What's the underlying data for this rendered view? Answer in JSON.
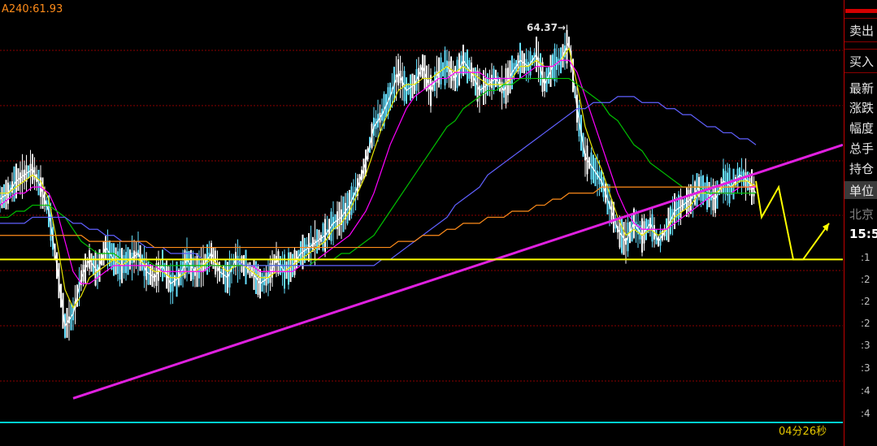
{
  "chart": {
    "ma_label": "A240:61.93",
    "peak_label": "64.37→",
    "countdown": "04分26秒"
  },
  "side_panel": {
    "sell_label": "卖出",
    "buy_label": "买入",
    "info_rows": [
      "最新",
      "涨跌",
      "幅度",
      "总手",
      "持仓"
    ],
    "unit_label": "单位",
    "city_label": "北京",
    "time_label": "15:5",
    "tick_labels": [
      ":1",
      ":2",
      ":2",
      ":2",
      ":3",
      ":3",
      ":4",
      ":4"
    ]
  },
  "colors": {
    "background": "#000000",
    "grid": "#8b0000",
    "trendline": "#e020e0",
    "support": "#ffff00",
    "bottom_line": "#00d0d0",
    "ma_white": "#ffffff",
    "ma_yellow": "#e6e600",
    "ma_magenta": "#ff00ff",
    "ma_green": "#00c000",
    "ma_blue": "#6060ff",
    "ma_orange": "#ff8c1a",
    "candle_up": "#66e0ff",
    "candle_down": "#ffffff"
  },
  "chart_data": {
    "type": "line",
    "title": "",
    "xlabel": "",
    "ylabel": "",
    "ylim": [
      58.0,
      65.0
    ],
    "peak": 64.37,
    "ma240": 61.93,
    "grid": true,
    "x": [
      0,
      10,
      20,
      30,
      40,
      50,
      60,
      70,
      80,
      90,
      100,
      110,
      120,
      130,
      140,
      150,
      160,
      170,
      180,
      190,
      200,
      210,
      220,
      230,
      240,
      250,
      260,
      270,
      280,
      290,
      300,
      310,
      320,
      330,
      340,
      350,
      360,
      370,
      380,
      390,
      400,
      410,
      420,
      430,
      440,
      450,
      460,
      470,
      480,
      490,
      500,
      510,
      520,
      530,
      540,
      550,
      560,
      570,
      580,
      590,
      600,
      610,
      620,
      630,
      640,
      650,
      660,
      670,
      680,
      690,
      700,
      710,
      720,
      730,
      740,
      750,
      760,
      770,
      780,
      790,
      800,
      810,
      820,
      830,
      840,
      850,
      860,
      870,
      880,
      890,
      900,
      910,
      920,
      930
    ],
    "series": [
      {
        "values": [
          61.7,
          61.8,
          62.0,
          62.1,
          62.2,
          61.9,
          61.5,
          60.6,
          59.6,
          59.8,
          60.4,
          60.7,
          60.5,
          60.9,
          60.7,
          60.6,
          60.7,
          60.8,
          60.5,
          60.4,
          60.6,
          60.3,
          60.4,
          60.7,
          60.5,
          60.6,
          60.8,
          60.5,
          60.4,
          60.7,
          60.6,
          60.5,
          60.3,
          60.4,
          60.7,
          60.5,
          60.6,
          60.8,
          60.9,
          61.0,
          61.1,
          61.3,
          61.4,
          61.6,
          61.9,
          62.3,
          62.9,
          63.1,
          63.4,
          63.8,
          63.5,
          63.6,
          63.9,
          63.5,
          63.8,
          63.9,
          63.7,
          64.0,
          63.8,
          63.5,
          63.6,
          63.7,
          63.5,
          63.8,
          64.0,
          63.9,
          64.1,
          63.6,
          63.9,
          64.0,
          64.3,
          63.2,
          62.4,
          62.2,
          62.0,
          61.6,
          61.2,
          61.0,
          61.3,
          61.1,
          61.3,
          61.0,
          61.2,
          61.5,
          61.6,
          61.7,
          61.9,
          61.8,
          61.7,
          62.0,
          61.9,
          62.1,
          62.0,
          61.8
        ]
      },
      {
        "values": [
          61.8,
          61.8,
          61.9,
          62.0,
          62.1,
          62.0,
          61.7,
          61.0,
          60.2,
          59.9,
          60.1,
          60.4,
          60.5,
          60.6,
          60.7,
          60.6,
          60.7,
          60.7,
          60.6,
          60.5,
          60.5,
          60.4,
          60.4,
          60.5,
          60.5,
          60.6,
          60.7,
          60.6,
          60.5,
          60.6,
          60.6,
          60.5,
          60.4,
          60.4,
          60.5,
          60.5,
          60.6,
          60.7,
          60.8,
          60.9,
          61.0,
          61.2,
          61.3,
          61.5,
          61.8,
          62.1,
          62.5,
          62.9,
          63.2,
          63.5,
          63.6,
          63.6,
          63.7,
          63.7,
          63.8,
          63.9,
          63.8,
          63.9,
          63.8,
          63.7,
          63.6,
          63.6,
          63.6,
          63.7,
          63.9,
          63.9,
          64.0,
          63.9,
          63.9,
          64.0,
          64.2,
          63.6,
          62.9,
          62.5,
          62.2,
          61.8,
          61.4,
          61.1,
          61.2,
          61.1,
          61.2,
          61.1,
          61.2,
          61.4,
          61.5,
          61.6,
          61.8,
          61.8,
          61.8,
          61.9,
          61.9,
          62.0,
          62.0,
          61.9
        ]
      },
      {
        "values": [
          61.6,
          61.7,
          61.8,
          61.8,
          61.9,
          61.9,
          61.8,
          61.5,
          61.0,
          60.5,
          60.3,
          60.3,
          60.4,
          60.5,
          60.6,
          60.6,
          60.6,
          60.6,
          60.6,
          60.6,
          60.5,
          60.5,
          60.5,
          60.5,
          60.5,
          60.5,
          60.6,
          60.6,
          60.6,
          60.6,
          60.6,
          60.6,
          60.5,
          60.5,
          60.5,
          60.5,
          60.5,
          60.6,
          60.6,
          60.7,
          60.8,
          60.9,
          61.0,
          61.1,
          61.3,
          61.5,
          61.8,
          62.2,
          62.6,
          62.9,
          63.2,
          63.4,
          63.5,
          63.6,
          63.7,
          63.7,
          63.8,
          63.8,
          63.8,
          63.8,
          63.7,
          63.7,
          63.7,
          63.7,
          63.7,
          63.8,
          63.9,
          63.9,
          63.9,
          64.0,
          64.0,
          63.8,
          63.4,
          63.0,
          62.6,
          62.2,
          61.8,
          61.5,
          61.3,
          61.2,
          61.2,
          61.2,
          61.2,
          61.3,
          61.4,
          61.5,
          61.6,
          61.7,
          61.8,
          61.8,
          61.8,
          61.9,
          61.9,
          61.9
        ]
      },
      {
        "values": [
          61.4,
          61.4,
          61.5,
          61.5,
          61.6,
          61.6,
          61.6,
          61.5,
          61.4,
          61.2,
          61.0,
          60.9,
          60.8,
          60.8,
          60.8,
          60.7,
          60.7,
          60.7,
          60.7,
          60.6,
          60.6,
          60.6,
          60.6,
          60.6,
          60.6,
          60.6,
          60.6,
          60.6,
          60.6,
          60.6,
          60.6,
          60.6,
          60.6,
          60.6,
          60.6,
          60.6,
          60.6,
          60.6,
          60.6,
          60.7,
          60.7,
          60.7,
          60.8,
          60.8,
          60.9,
          61.0,
          61.1,
          61.3,
          61.5,
          61.7,
          61.9,
          62.1,
          62.3,
          62.5,
          62.7,
          62.9,
          63.0,
          63.2,
          63.3,
          63.4,
          63.5,
          63.5,
          63.6,
          63.6,
          63.7,
          63.7,
          63.7,
          63.7,
          63.7,
          63.7,
          63.7,
          63.6,
          63.5,
          63.4,
          63.3,
          63.1,
          63.0,
          62.8,
          62.6,
          62.5,
          62.3,
          62.2,
          62.1,
          62.0,
          61.9,
          61.9,
          61.9,
          61.8,
          61.8,
          61.8,
          61.8,
          61.8,
          61.8,
          61.8
        ]
      },
      {
        "values": [
          61.3,
          61.3,
          61.3,
          61.3,
          61.4,
          61.4,
          61.4,
          61.4,
          61.4,
          61.3,
          61.3,
          61.2,
          61.2,
          61.1,
          61.1,
          61.0,
          61.0,
          61.0,
          60.9,
          60.9,
          60.9,
          60.8,
          60.8,
          60.8,
          60.8,
          60.7,
          60.7,
          60.7,
          60.7,
          60.7,
          60.6,
          60.6,
          60.6,
          60.6,
          60.6,
          60.6,
          60.6,
          60.6,
          60.6,
          60.6,
          60.6,
          60.6,
          60.6,
          60.6,
          60.6,
          60.6,
          60.6,
          60.7,
          60.7,
          60.8,
          60.9,
          61.0,
          61.1,
          61.2,
          61.3,
          61.4,
          61.6,
          61.7,
          61.8,
          61.9,
          62.1,
          62.2,
          62.3,
          62.4,
          62.5,
          62.6,
          62.7,
          62.8,
          62.9,
          63.0,
          63.1,
          63.2,
          63.2,
          63.3,
          63.3,
          63.3,
          63.4,
          63.4,
          63.4,
          63.3,
          63.3,
          63.3,
          63.2,
          63.2,
          63.1,
          63.1,
          63.0,
          62.9,
          62.9,
          62.8,
          62.8,
          62.7,
          62.7,
          62.6
        ]
      },
      {
        "values": [
          61.1,
          61.1,
          61.1,
          61.1,
          61.1,
          61.1,
          61.1,
          61.1,
          61.1,
          61.1,
          61.1,
          61.0,
          61.0,
          61.0,
          61.0,
          61.0,
          61.0,
          61.0,
          61.0,
          60.9,
          60.9,
          60.9,
          60.9,
          60.9,
          60.9,
          60.9,
          60.9,
          60.9,
          60.9,
          60.9,
          60.9,
          60.9,
          60.9,
          60.9,
          60.9,
          60.9,
          60.9,
          60.9,
          60.9,
          60.9,
          60.9,
          60.9,
          60.9,
          60.9,
          60.9,
          60.9,
          60.9,
          60.9,
          60.9,
          61.0,
          61.0,
          61.0,
          61.1,
          61.1,
          61.1,
          61.2,
          61.2,
          61.3,
          61.3,
          61.3,
          61.4,
          61.4,
          61.4,
          61.5,
          61.5,
          61.5,
          61.6,
          61.6,
          61.7,
          61.7,
          61.8,
          61.8,
          61.8,
          61.8,
          61.9,
          61.9,
          61.9,
          61.9,
          61.9,
          61.9,
          61.9,
          61.9,
          61.9,
          61.9,
          61.9,
          61.9,
          61.9,
          61.9,
          61.9,
          61.9,
          61.9,
          61.9,
          61.9,
          61.93
        ]
      }
    ],
    "trendline": {
      "x": [
        90,
        1037
      ],
      "y": [
        58.4,
        62.6
      ]
    },
    "support_line": {
      "y": 60.7
    },
    "projection": {
      "x": [
        930,
        937,
        958,
        976,
        988,
        1020
      ],
      "y": [
        62.0,
        61.4,
        61.9,
        60.7,
        60.7,
        61.3
      ]
    }
  }
}
